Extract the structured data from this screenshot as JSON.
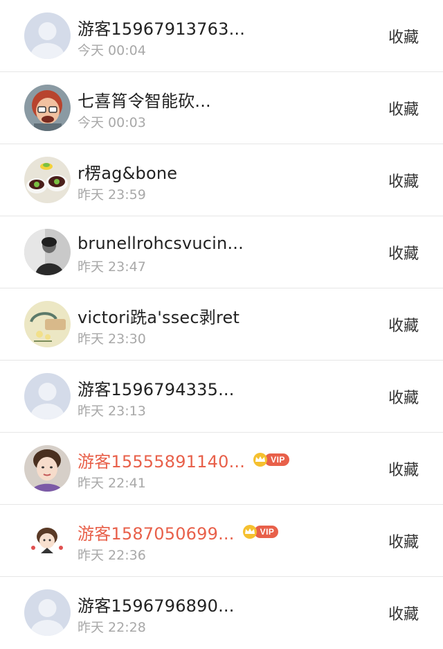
{
  "contacts": [
    {
      "name": "游客15967913763...",
      "time": "今天 00:04",
      "action": "收藏",
      "vip": false,
      "avatar": "default-avatar"
    },
    {
      "name": "七喜筲令智能砍...",
      "time": "今天 00:03",
      "action": "收藏",
      "vip": false,
      "avatar": "cartoon-avatar"
    },
    {
      "name": "r楞ag&bone",
      "time": "昨天 23:59",
      "action": "收藏",
      "vip": false,
      "avatar": "food-photo-avatar"
    },
    {
      "name": "brunellrohcsvucin...",
      "time": "昨天 23:47",
      "action": "收藏",
      "vip": false,
      "avatar": "person-photo-avatar"
    },
    {
      "name": "victori跣a'ssec剥ret",
      "time": "昨天 23:30",
      "action": "收藏",
      "vip": false,
      "avatar": "plate-photo-avatar"
    },
    {
      "name": "游客1596794335...",
      "time": "昨天 23:13",
      "action": "收藏",
      "vip": false,
      "avatar": "default-avatar"
    },
    {
      "name": "游客15555891140...",
      "time": "昨天 22:41",
      "action": "收藏",
      "vip": true,
      "vip_label": "VIP",
      "avatar": "woman-photo-avatar"
    },
    {
      "name": "游客1587050699...",
      "time": "昨天 22:36",
      "action": "收藏",
      "vip": true,
      "vip_label": "VIP",
      "avatar": "girl-cartoon-avatar"
    },
    {
      "name": "游客1596796890...",
      "time": "昨天 22:28",
      "action": "收藏",
      "vip": false,
      "avatar": "default-avatar"
    }
  ],
  "colors": {
    "name": "#222222",
    "vip_name": "#e8604a",
    "time": "#a8a8a8",
    "divider": "#e6e6e6",
    "vip_badge": "#e8604a"
  }
}
